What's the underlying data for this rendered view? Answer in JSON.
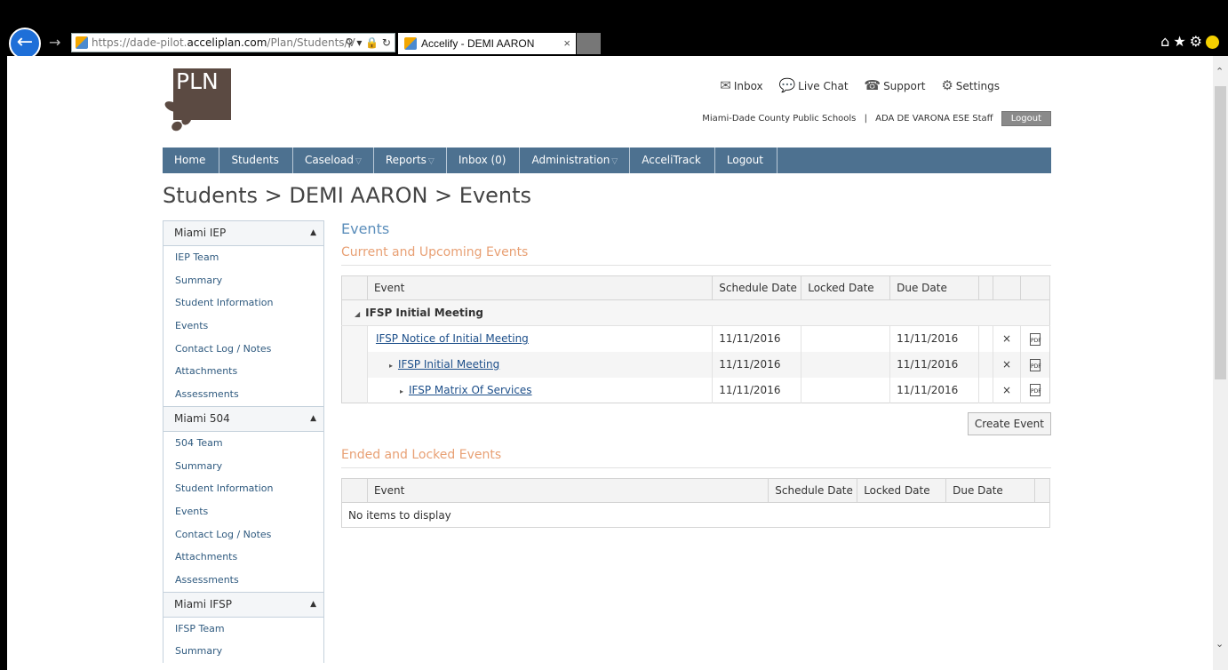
{
  "browser": {
    "url_prefix": "https://dade-pilot.",
    "url_domain": "acceliplan.com",
    "url_rest": "/Plan/Students/V",
    "url_tools": "⚲ ▾ 🔒 ↻",
    "tab_title": "Accelify - DEMI AARON",
    "tab_close": "×",
    "back": "←",
    "forward": "→"
  },
  "logo": {
    "text": "PLN"
  },
  "top_links": {
    "inbox": "Inbox",
    "live_chat": "Live Chat",
    "support": "Support",
    "settings": "Settings"
  },
  "user_line": {
    "district": "Miami-Dade County Public Schools",
    "separator": "|",
    "user": "ADA DE VARONA ESE Staff",
    "logout": "Logout"
  },
  "nav": [
    {
      "label": "Home",
      "caret": ""
    },
    {
      "label": "Students",
      "caret": ""
    },
    {
      "label": "Caseload",
      "caret": "▽"
    },
    {
      "label": "Reports",
      "caret": "▽"
    },
    {
      "label": "Inbox (0)",
      "caret": ""
    },
    {
      "label": "Administration",
      "caret": "▽"
    },
    {
      "label": "AcceliTrack",
      "caret": ""
    },
    {
      "label": "Logout",
      "caret": ""
    }
  ],
  "page_title": "Students > DEMI AARON > Events",
  "sidebar": {
    "iep": {
      "title": "Miami IEP",
      "items": [
        "IEP Team",
        "Summary",
        "Student Information",
        "Events",
        "Contact Log / Notes",
        "Attachments",
        "Assessments"
      ]
    },
    "s504": {
      "title": "Miami 504",
      "items": [
        "504 Team",
        "Summary",
        "Student Information",
        "Events",
        "Contact Log / Notes",
        "Attachments",
        "Assessments"
      ]
    },
    "ifsp": {
      "title": "Miami IFSP",
      "items": [
        "IFSP Team",
        "Summary"
      ]
    }
  },
  "main": {
    "heading": "Events",
    "current_heading": "Current and Upcoming Events",
    "ended_heading": "Ended and Locked Events",
    "columns": {
      "event": "Event",
      "schedule": "Schedule Date",
      "locked": "Locked Date",
      "due": "Due Date"
    },
    "group": "IFSP Initial Meeting",
    "rows": [
      {
        "event": "IFSP Notice of Initial Meeting",
        "schedule": "11/11/2016",
        "locked": "",
        "due": "11/11/2016"
      },
      {
        "event": "IFSP Initial Meeting",
        "schedule": "11/11/2016",
        "locked": "",
        "due": "11/11/2016"
      },
      {
        "event": "IFSP Matrix Of Services",
        "schedule": "11/11/2016",
        "locked": "",
        "due": "11/11/2016"
      }
    ],
    "delete_glyph": "×",
    "pdf_glyph": "PDF",
    "create_button": "Create Event",
    "empty_text": "No items to display"
  }
}
